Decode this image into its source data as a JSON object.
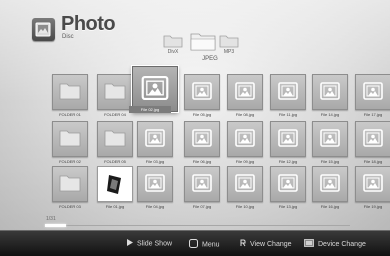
{
  "header": {
    "title": "Photo",
    "subtitle": "Disc"
  },
  "top_folders": [
    {
      "label": "DivX",
      "icon": "folder-icon"
    },
    {
      "label": "",
      "icon": "folder-open-icon"
    },
    {
      "label": "MP3",
      "icon": "folder-icon"
    }
  ],
  "current_folder": "JPEG",
  "grid": {
    "rows": [
      [
        "FOLDER 01",
        "FOLDER 04",
        "File 02.jpg",
        "File 05.jpg",
        "File 08.jpg",
        "File 11.jpg",
        "File 14.jpg",
        "File 17.jpg"
      ],
      [
        "FOLDER 02",
        "FOLDER 05",
        "File 03.jpg",
        "File 06.jpg",
        "File 09.jpg",
        "File 12.jpg",
        "File 15.jpg",
        "File 18.jpg"
      ],
      [
        "FOLDER 03",
        "File 01.jpg",
        "File 04.jpg",
        "File 07.jpg",
        "File 10.jpg",
        "File 13.jpg",
        "File 16.jpg",
        "File 19.jpg"
      ]
    ],
    "selected": "File 02.jpg"
  },
  "page": {
    "indicator": "1/31",
    "progress": 0.07
  },
  "footer": {
    "slideshow": "Slide Show",
    "menu": "Menu",
    "view_change": "View Change",
    "device_change": "Device Change"
  },
  "colors": {
    "folder": "#e6e6e6",
    "photo_icon": "#ffffff",
    "footer_bg": "#1c1c1c"
  }
}
